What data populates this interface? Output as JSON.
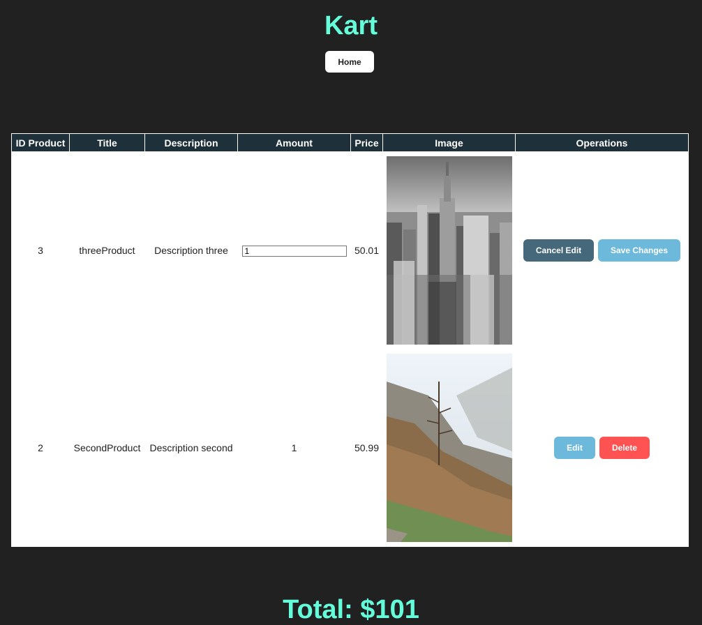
{
  "app": {
    "title": "Kart"
  },
  "nav": {
    "home_label": "Home"
  },
  "table": {
    "headers": [
      "ID Product",
      "Title",
      "Description",
      "Amount",
      "Price",
      "Image",
      "Operations"
    ],
    "rows": [
      {
        "id": "3",
        "title": "threeProduct",
        "description": "Description three",
        "amount": "1",
        "price": "50.01",
        "image": "city-skyline-image",
        "editing": true,
        "buttons": [
          "Cancel Edit",
          "Save Changes"
        ]
      },
      {
        "id": "2",
        "title": "SecondProduct",
        "description": "Description second",
        "amount": "1",
        "price": "50.99",
        "image": "mountain-forest-image",
        "editing": false,
        "buttons": [
          "Edit",
          "Delete"
        ]
      }
    ]
  },
  "total": {
    "label": "Total: $101"
  },
  "colors": {
    "background": "#212121",
    "accent": "#64ffda",
    "header": "#1e3039",
    "cancel": "#45687b",
    "save": "#6cb9dc",
    "edit": "#6cb9dc",
    "delete": "#ff5252"
  }
}
